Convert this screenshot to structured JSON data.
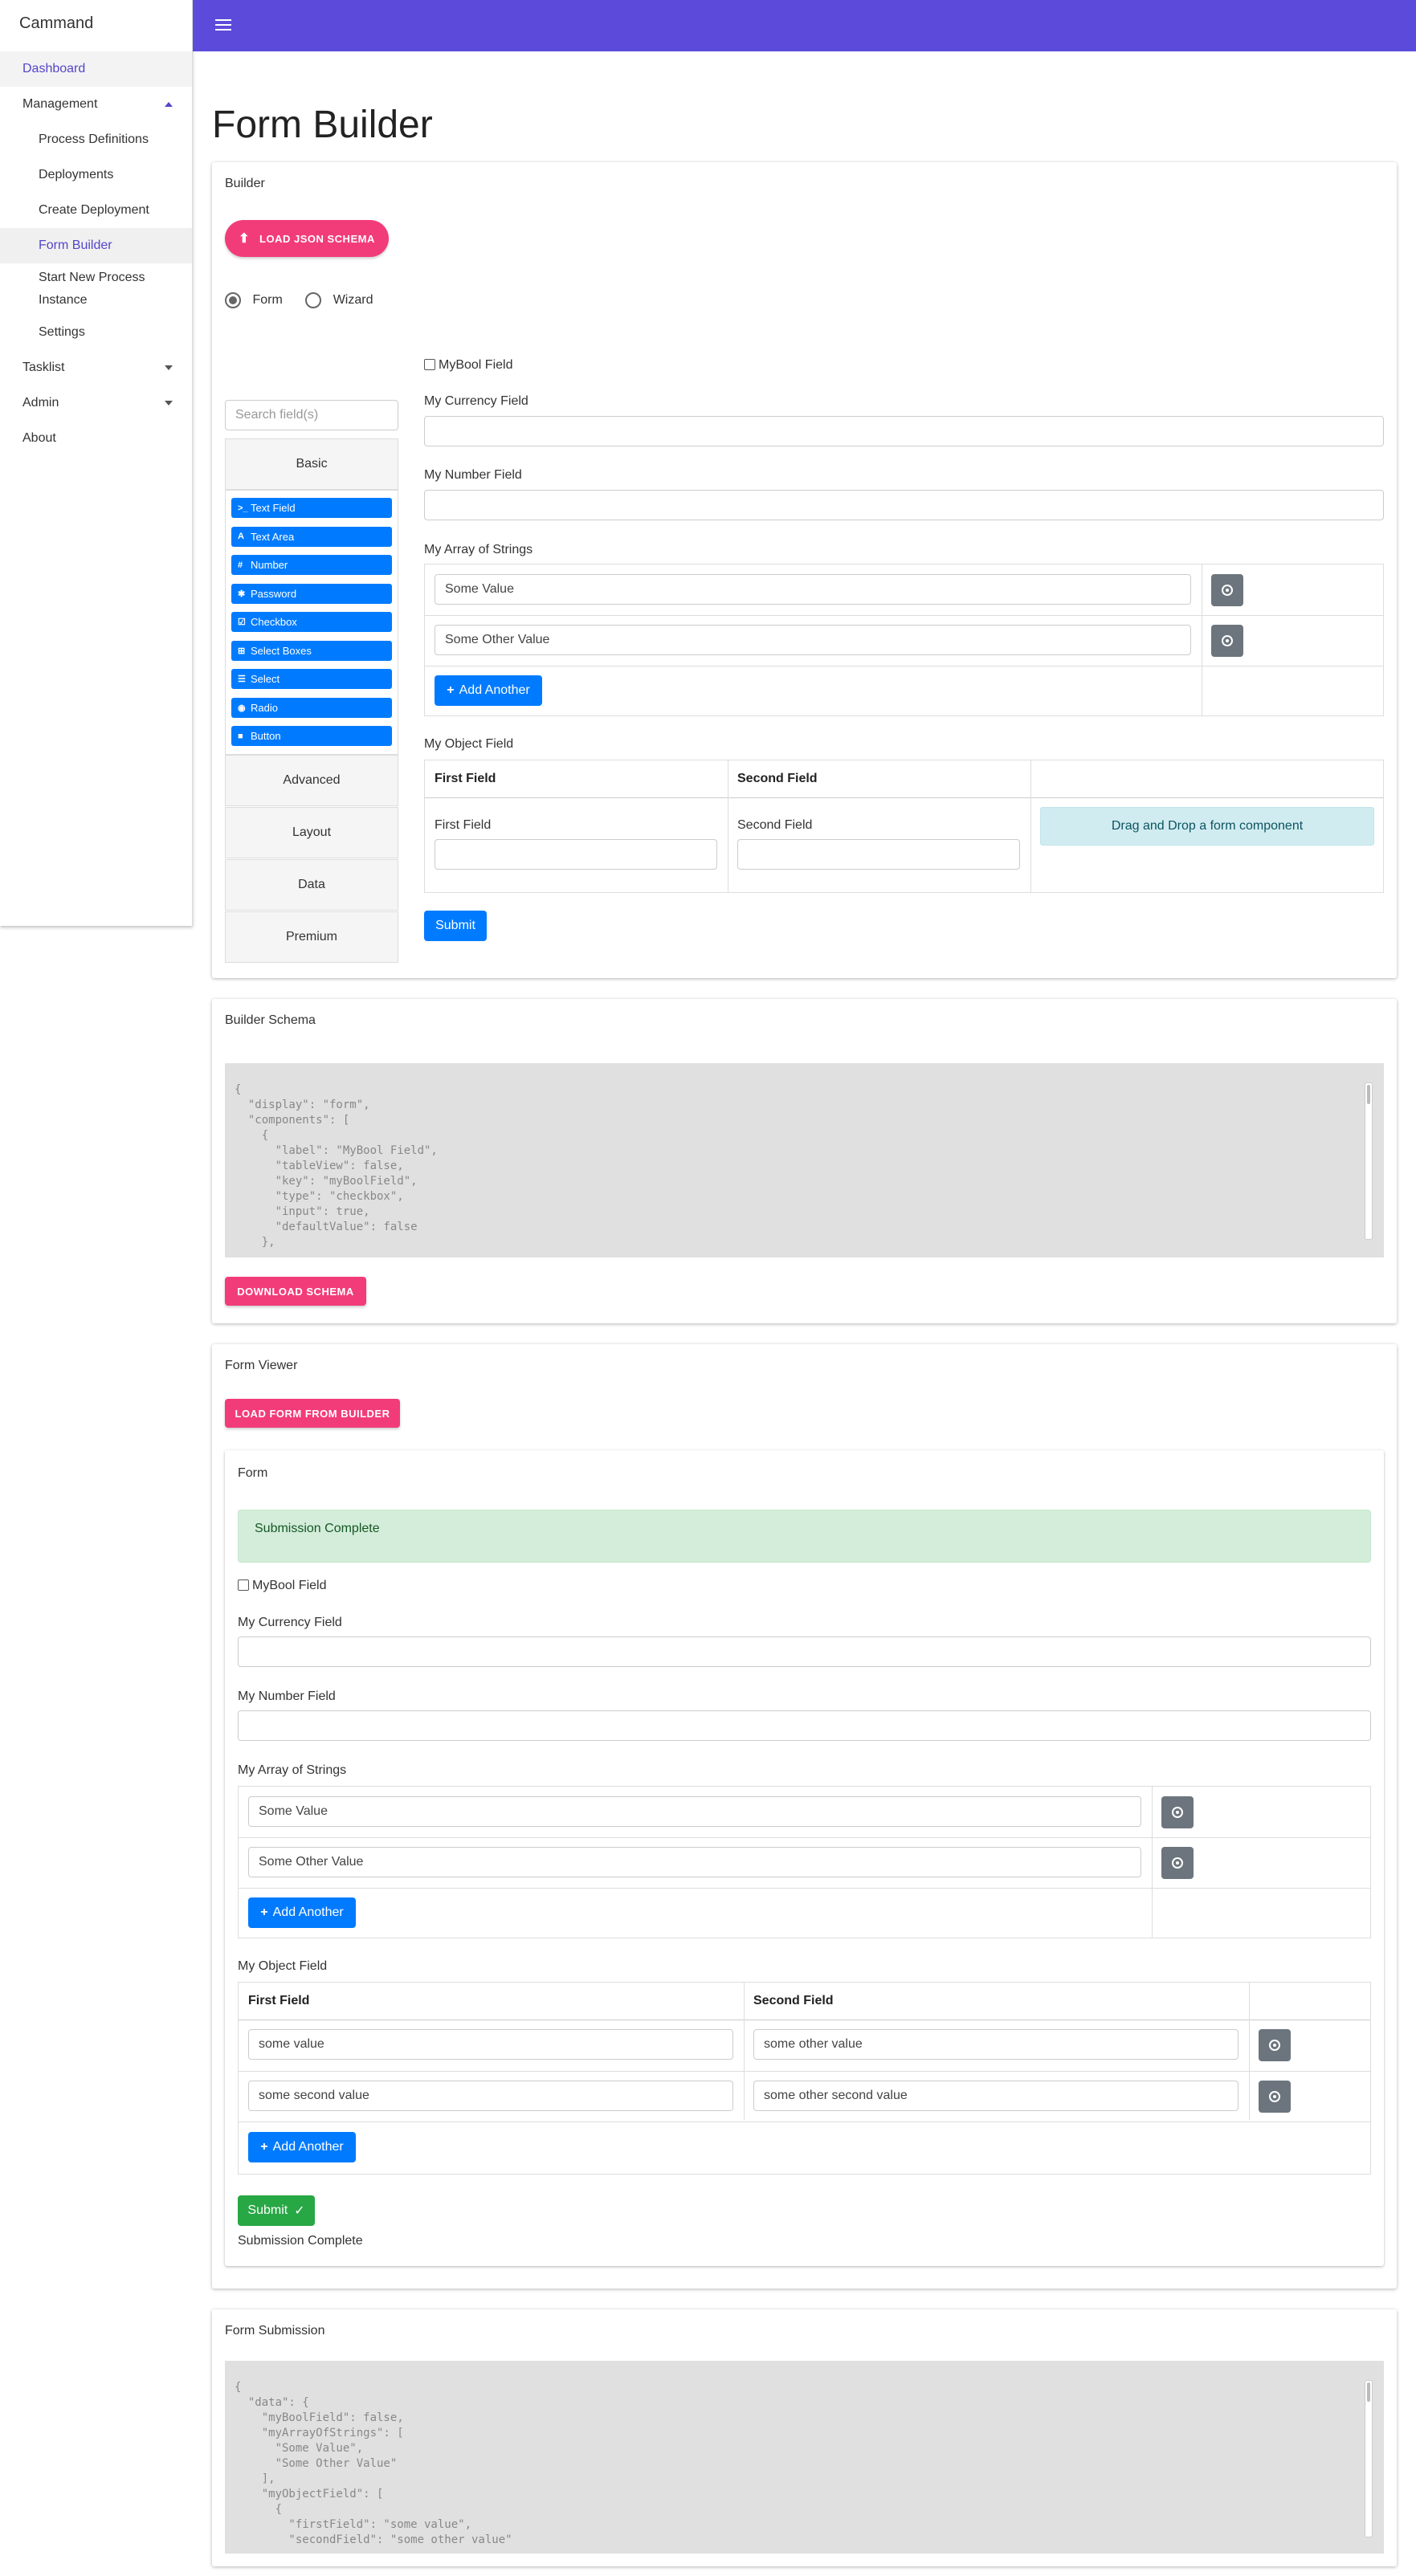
{
  "app": {
    "brand": "Cammand"
  },
  "sidebar": {
    "dashboard": "Dashboard",
    "management": "Management",
    "process_definitions": "Process Definitions",
    "deployments": "Deployments",
    "create_deployment": "Create Deployment",
    "form_builder": "Form Builder",
    "start_process_l1": "Start New Process",
    "start_process_l2": "Instance",
    "settings": "Settings",
    "tasklist": "Tasklist",
    "admin": "Admin",
    "about": "About"
  },
  "page": {
    "title": "Form Builder"
  },
  "builder": {
    "title": "Builder",
    "load_json": "LOAD JSON SCHEMA",
    "radio_form": "Form",
    "radio_wizard": "Wizard",
    "search_placeholder": "Search field(s)",
    "groups": {
      "basic": "Basic",
      "advanced": "Advanced",
      "layout": "Layout",
      "data": "Data",
      "premium": "Premium"
    },
    "components": [
      {
        "icon": ">_",
        "label": "Text Field"
      },
      {
        "icon": "A",
        "label": "Text Area"
      },
      {
        "icon": "#",
        "label": "Number"
      },
      {
        "icon": "✱",
        "label": "Password"
      },
      {
        "icon": "☑",
        "label": "Checkbox"
      },
      {
        "icon": "⊞",
        "label": "Select Boxes"
      },
      {
        "icon": "☰",
        "label": "Select"
      },
      {
        "icon": "◉",
        "label": "Radio"
      },
      {
        "icon": "■",
        "label": "Button"
      }
    ],
    "bool_field": "MyBool Field",
    "currency_field": "My Currency Field",
    "number_field": "My Number Field",
    "array_field": "My Array of Strings",
    "array_values": [
      "Some Value",
      "Some Other Value"
    ],
    "add_another": "Add Another",
    "object_field": "My Object Field",
    "first_field": "First Field",
    "second_field": "Second Field",
    "drag_drop": "Drag and Drop a form component",
    "submit": "Submit"
  },
  "schema": {
    "title": "Builder Schema",
    "code": "{\n  \"display\": \"form\",\n  \"components\": [\n    {\n      \"label\": \"MyBool Field\",\n      \"tableView\": false,\n      \"key\": \"myBoolField\",\n      \"type\": \"checkbox\",\n      \"input\": true,\n      \"defaultValue\": false\n    },",
    "download": "DOWNLOAD SCHEMA"
  },
  "viewer": {
    "title": "Form Viewer",
    "load_form": "LOAD FORM FROM BUILDER",
    "form_title": "Form",
    "alert": "Submission Complete",
    "bool_field": "MyBool Field",
    "currency_field": "My Currency Field",
    "number_field": "My Number Field",
    "array_field": "My Array of Strings",
    "array_values": [
      "Some Value",
      "Some Other Value"
    ],
    "add_another": "Add Another",
    "object_field": "My Object Field",
    "first_field": "First Field",
    "second_field": "Second Field",
    "object_rows": [
      [
        "some value",
        "some other value"
      ],
      [
        "some second value",
        "some other second value"
      ]
    ],
    "submit": "Submit",
    "submit_check": "✓",
    "complete": "Submission Complete"
  },
  "submission": {
    "title": "Form Submission",
    "code": "{\n  \"data\": {\n    \"myBoolField\": false,\n    \"myArrayOfStrings\": [\n      \"Some Value\",\n      \"Some Other Value\"\n    ],\n    \"myObjectField\": [\n      {\n        \"firstField\": \"some value\",\n        \"secondField\": \"some other value\""
  }
}
